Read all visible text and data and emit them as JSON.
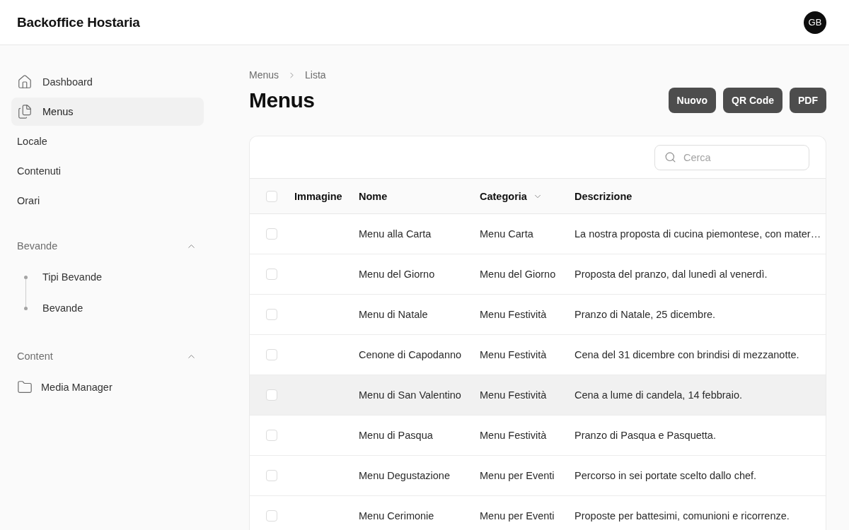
{
  "app": {
    "title": "Backoffice Hostaria",
    "avatar": "GB"
  },
  "sidebar": {
    "items": [
      {
        "kind": "home",
        "label": "Dashboard",
        "selected": false
      },
      {
        "kind": "pages",
        "label": "Menus",
        "selected": true
      },
      {
        "kind": "plain",
        "label": "Locale",
        "selected": false
      },
      {
        "kind": "plain",
        "label": "Contenuti",
        "selected": false
      },
      {
        "kind": "plain",
        "label": "Orari",
        "selected": false
      }
    ],
    "groups": [
      {
        "label": "Bevande",
        "expanded": true,
        "items": [
          {
            "kind": "bullet",
            "label": "Tipi Bevande",
            "selected": false
          },
          {
            "kind": "bullet",
            "label": "Bevande",
            "selected": false
          }
        ]
      },
      {
        "label": "Content",
        "expanded": true,
        "items": [
          {
            "kind": "folder",
            "label": "Media Manager",
            "selected": false
          }
        ]
      }
    ]
  },
  "breadcrumb": [
    "Menus",
    "Lista"
  ],
  "page": {
    "title": "Menus",
    "actions": [
      "Nuovo",
      "QR Code",
      "PDF"
    ]
  },
  "table": {
    "search": {
      "placeholder": "Cerca"
    },
    "select_all": {
      "checked": false
    },
    "columns": [
      {
        "label": "Immagine",
        "sortable": false
      },
      {
        "label": "Nome",
        "sortable": false
      },
      {
        "label": "Categoria",
        "sortable": true
      },
      {
        "label": "Descrizione",
        "sortable": false
      }
    ],
    "rows": [
      {
        "checked": false,
        "highlighted": false,
        "name": "Menu alla Carta",
        "category": "Menu Carta",
        "description": "La nostra proposta di cucina piemontese, con mater…"
      },
      {
        "checked": false,
        "highlighted": false,
        "name": "Menu del Giorno",
        "category": "Menu del Giorno",
        "description": "Proposta del pranzo, dal lunedì al venerdì."
      },
      {
        "checked": false,
        "highlighted": false,
        "name": "Menu di Natale",
        "category": "Menu Festività",
        "description": "Pranzo di Natale, 25 dicembre."
      },
      {
        "checked": false,
        "highlighted": false,
        "name": "Cenone di Capodanno",
        "category": "Menu Festività",
        "description": "Cena del 31 dicembre con brindisi di mezzanotte."
      },
      {
        "checked": false,
        "highlighted": true,
        "name": "Menu di San Valentino",
        "category": "Menu Festività",
        "description": "Cena a lume di candela, 14 febbraio."
      },
      {
        "checked": false,
        "highlighted": false,
        "name": "Menu di Pasqua",
        "category": "Menu Festività",
        "description": "Pranzo di Pasqua e Pasquetta."
      },
      {
        "checked": false,
        "highlighted": false,
        "name": "Menu Degustazione",
        "category": "Menu per Eventi",
        "description": "Percorso in sei portate scelto dallo chef."
      },
      {
        "checked": false,
        "highlighted": false,
        "name": "Menu Cerimonie",
        "category": "Menu per Eventi",
        "description": "Proposte per battesimi, comunioni e ricorrenze."
      }
    ]
  }
}
